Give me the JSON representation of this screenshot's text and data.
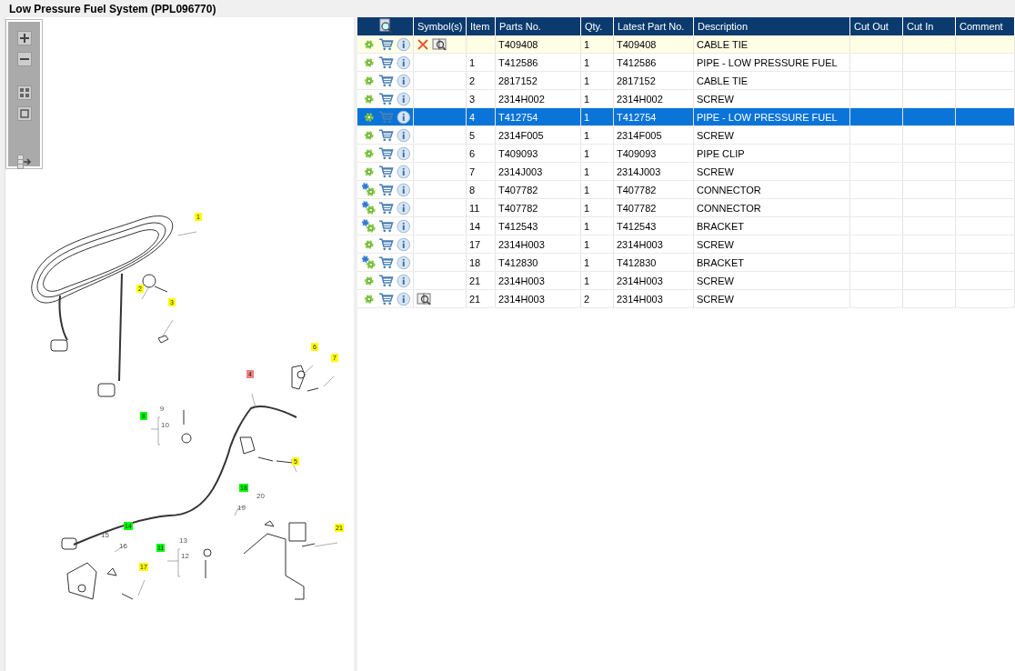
{
  "title": "Low Pressure Fuel System (PPL096770)",
  "toolbar": [
    {
      "kind": "zoom-in"
    },
    {
      "kind": "zoom-out"
    },
    {
      "kind": "fit"
    },
    {
      "kind": "actual"
    },
    {
      "kind": "layout"
    }
  ],
  "callouts": [
    {
      "label": "1",
      "color": "#ffff00"
    },
    {
      "label": "2",
      "color": "#ffff00"
    },
    {
      "label": "3",
      "color": "#ffff00"
    },
    {
      "label": "6",
      "color": "#ffff00"
    },
    {
      "label": "7",
      "color": "#ffff00"
    },
    {
      "label": "4",
      "color": "#f08080"
    },
    {
      "label": "8",
      "color": "#00ff00"
    },
    {
      "label": "9"
    },
    {
      "label": "10"
    },
    {
      "label": "5",
      "color": "#ffff00"
    },
    {
      "label": "18",
      "color": "#00ff00"
    },
    {
      "label": "20"
    },
    {
      "label": "19"
    },
    {
      "label": "14",
      "color": "#00ff00"
    },
    {
      "label": "15"
    },
    {
      "label": "16"
    },
    {
      "label": "21",
      "color": "#ffff00"
    },
    {
      "label": "11",
      "color": "#00ff00"
    },
    {
      "label": "13"
    },
    {
      "label": "12"
    },
    {
      "label": "17",
      "color": "#ffff00"
    }
  ],
  "table": {
    "columns": [
      "Symbol(s)",
      "Item",
      "Parts No.",
      "Qty.",
      "Latest Part No.",
      "Description",
      "Cut Out",
      "Cut In",
      "Comment"
    ],
    "rows": [
      {
        "kind": "single",
        "symbols": [
          {
            "kind": "remove"
          },
          {
            "kind": "reference"
          }
        ],
        "item": "",
        "part": "T409408",
        "qty": "1",
        "latest": "T409408",
        "description": "CABLE TIE",
        "highlighted": true,
        "selected": false
      },
      {
        "kind": "single",
        "symbols": [],
        "item": "1",
        "part": "T412586",
        "qty": "1",
        "latest": "T412586",
        "description": "PIPE - LOW PRESSURE FUEL",
        "highlighted": false,
        "selected": false
      },
      {
        "kind": "single",
        "symbols": [],
        "item": "2",
        "part": "2817152",
        "qty": "1",
        "latest": "2817152",
        "description": "CABLE TIE",
        "highlighted": false,
        "selected": false
      },
      {
        "kind": "single",
        "symbols": [],
        "item": "3",
        "part": "2314H002",
        "qty": "1",
        "latest": "2314H002",
        "description": "SCREW",
        "highlighted": false,
        "selected": false
      },
      {
        "kind": "single",
        "symbols": [],
        "item": "4",
        "part": "T412754",
        "qty": "1",
        "latest": "T412754",
        "description": "PIPE - LOW PRESSURE FUEL",
        "highlighted": false,
        "selected": true
      },
      {
        "kind": "single",
        "symbols": [],
        "item": "5",
        "part": "2314F005",
        "qty": "1",
        "latest": "2314F005",
        "description": "SCREW",
        "highlighted": false,
        "selected": false
      },
      {
        "kind": "single",
        "symbols": [],
        "item": "6",
        "part": "T409093",
        "qty": "1",
        "latest": "T409093",
        "description": "PIPE CLIP",
        "highlighted": false,
        "selected": false
      },
      {
        "kind": "single",
        "symbols": [],
        "item": "7",
        "part": "2314J003",
        "qty": "1",
        "latest": "2314J003",
        "description": "SCREW",
        "highlighted": false,
        "selected": false
      },
      {
        "kind": "double",
        "symbols": [],
        "item": "8",
        "part": "T407782",
        "qty": "1",
        "latest": "T407782",
        "description": "CONNECTOR",
        "highlighted": false,
        "selected": false
      },
      {
        "kind": "double",
        "symbols": [],
        "item": "11",
        "part": "T407782",
        "qty": "1",
        "latest": "T407782",
        "description": "CONNECTOR",
        "highlighted": false,
        "selected": false
      },
      {
        "kind": "double",
        "symbols": [],
        "item": "14",
        "part": "T412543",
        "qty": "1",
        "latest": "T412543",
        "description": "BRACKET",
        "highlighted": false,
        "selected": false
      },
      {
        "kind": "single",
        "symbols": [],
        "item": "17",
        "part": "2314H003",
        "qty": "1",
        "latest": "2314H003",
        "description": "SCREW",
        "highlighted": false,
        "selected": false
      },
      {
        "kind": "double",
        "symbols": [],
        "item": "18",
        "part": "T412830",
        "qty": "1",
        "latest": "T412830",
        "description": "BRACKET",
        "highlighted": false,
        "selected": false
      },
      {
        "kind": "single",
        "symbols": [],
        "item": "21",
        "part": "2314H003",
        "qty": "1",
        "latest": "2314H003",
        "description": "SCREW",
        "highlighted": false,
        "selected": false
      },
      {
        "kind": "single",
        "symbols": [
          {
            "kind": "reference"
          }
        ],
        "item": "21",
        "part": "2314H003",
        "qty": "2",
        "latest": "2314H003",
        "description": "SCREW",
        "highlighted": false,
        "selected": false
      }
    ]
  }
}
